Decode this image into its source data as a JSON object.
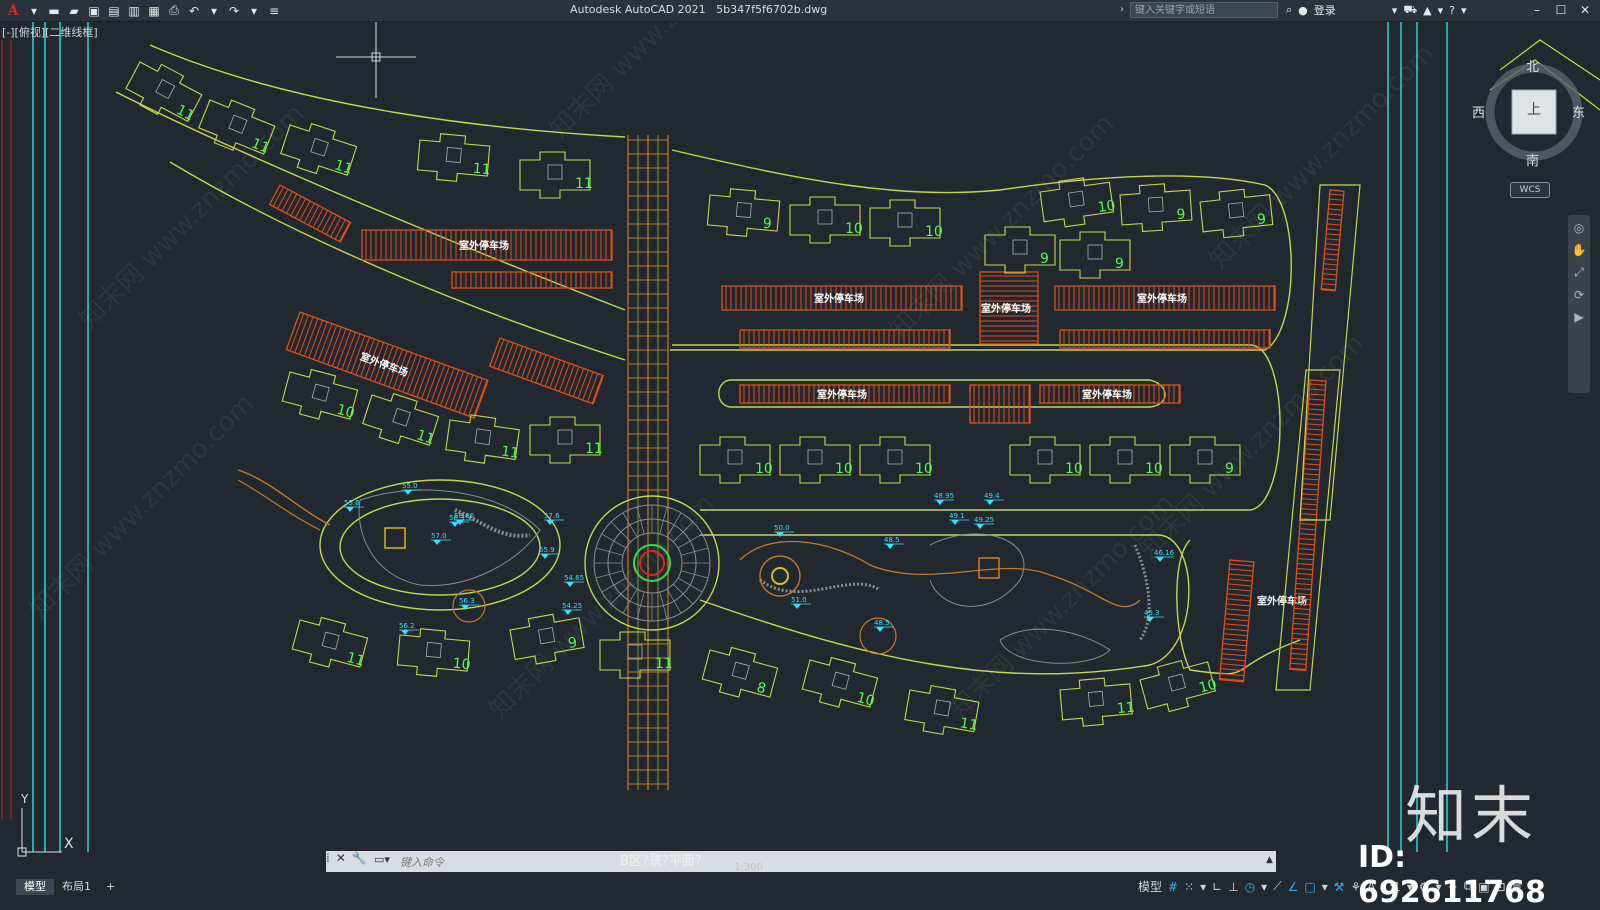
{
  "app": {
    "title": "Autodesk AutoCAD 2021",
    "file_name": "5b347f5f6702b.dwg",
    "search_placeholder": "键入关键字或短语",
    "login_label": "登录",
    "logo_glyph": "A"
  },
  "viewport": {
    "label": "[-][俯视][二维线框]"
  },
  "navcube": {
    "north": "北",
    "south": "南",
    "east": "东",
    "west": "西",
    "face": "上",
    "wcs": "WCS"
  },
  "drawing": {
    "parking_label": "室外停车场",
    "building_numbers": [
      "11",
      "11",
      "11",
      "11",
      "11",
      "9",
      "10",
      "10",
      "10",
      "9",
      "9",
      "10",
      "11",
      "11",
      "11",
      "10",
      "10",
      "10",
      "10",
      "10",
      "9",
      "9",
      "9",
      "11",
      "10",
      "9",
      "8",
      "10",
      "11",
      "11",
      "10",
      "11"
    ],
    "elevations": [
      "55.0",
      "55.6",
      "57.0",
      "56.66",
      "57.6",
      "56.3",
      "55.9",
      "54.65",
      "54.25",
      "56.3",
      "56.2",
      "50.0",
      "48.5",
      "49.1",
      "49.25",
      "48.95",
      "49.4",
      "51.0",
      "48.5",
      "46.16",
      "45.3"
    ],
    "scale_caption": "B区?景?平面?",
    "scale_text": "1:300"
  },
  "ucs": {
    "x_label": "X",
    "y_label": "Y"
  },
  "command": {
    "placeholder": "键入命令"
  },
  "status": {
    "tabs": [
      "模型",
      "布局1"
    ],
    "add_tab": "+",
    "model_label": "模型",
    "scale": "1:1"
  },
  "watermark": {
    "brand": "知末",
    "id_text": "ID: 692611768",
    "site": "www.znzmo.com",
    "cn_site": "知末网"
  }
}
